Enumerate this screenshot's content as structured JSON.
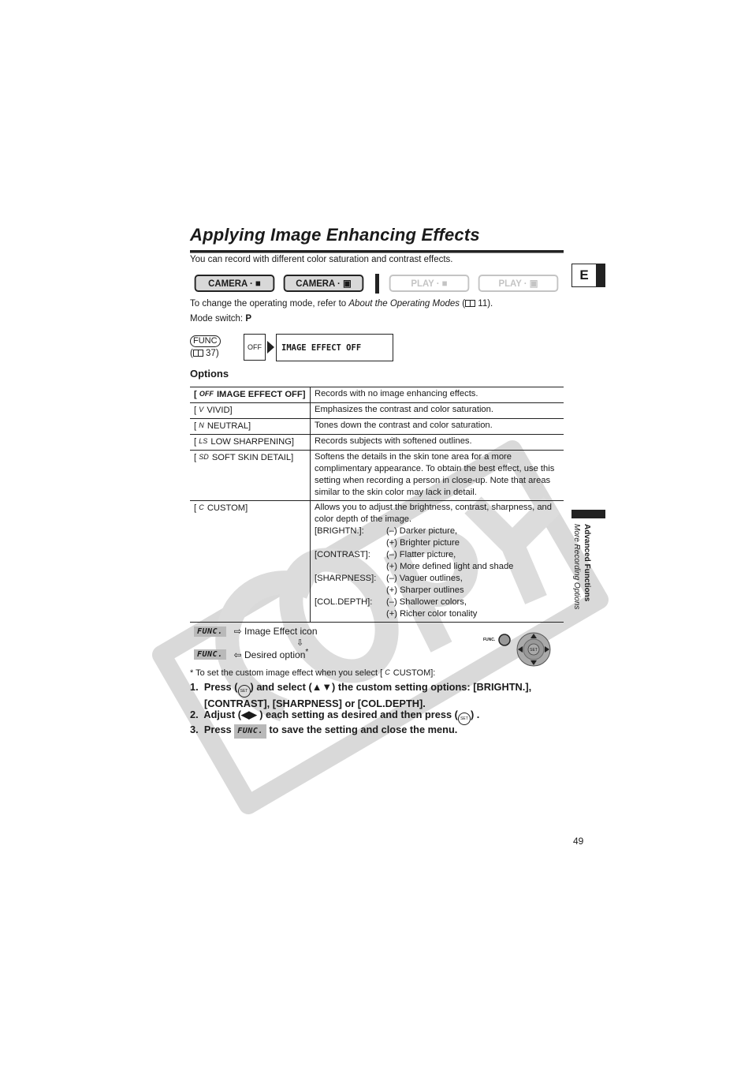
{
  "header": {
    "title": "Applying Image Enhancing Effects",
    "intro": "You can record with different color saturation and contrast effects."
  },
  "modes": [
    {
      "label": "CAMERA · ■",
      "glyph": "movie-camera",
      "active": true
    },
    {
      "label": "CAMERA · ▣",
      "glyph": "still-camera",
      "active": true
    },
    {
      "label": "PLAY · ■",
      "glyph": "movie-camera",
      "active": false
    },
    {
      "label": "PLAY · ▣",
      "glyph": "still-camera",
      "active": false
    }
  ],
  "language_tab": "E",
  "mode_ref": {
    "prefix": "To change the operating mode, refer to ",
    "title": "About the Operating Modes",
    "open": " (",
    "page": " 11).",
    "mode_switch_label": "Mode switch: ",
    "mode_switch_value": "P"
  },
  "func_ref": {
    "func_label": "FUNC",
    "page_open": "(",
    "page": " 37)",
    "lcd_icon": "OFF",
    "lcd_text": "IMAGE EFFECT OFF"
  },
  "options": {
    "heading": "Options",
    "rows": [
      {
        "icon": "OFF",
        "name": " IMAGE EFFECT OFF]",
        "desc": "Records with no image enhancing effects.",
        "bold": true
      },
      {
        "icon": "V",
        "name": " VIVID]",
        "desc": "Emphasizes the contrast and color saturation."
      },
      {
        "icon": "N",
        "name": " NEUTRAL]",
        "desc": "Tones down the contrast and color saturation."
      },
      {
        "icon": "LS",
        "name": " LOW SHARPENING]",
        "desc": "Records subjects with softened outlines."
      },
      {
        "icon": "SD",
        "name": " SOFT SKIN DETAIL]",
        "desc": "Softens the details in the skin tone area for a more complimentary appearance. To obtain the best effect, use this setting when recording a person in close-up. Note that areas similar to the skin color may lack in detail."
      },
      {
        "icon": "C",
        "name": " CUSTOM]",
        "desc": "Allows you to adjust the brightness, contrast, sharpness, and color depth of the image.",
        "settings": [
          {
            "key": "[BRIGHTN.]:",
            "minus": "(–) Darker picture,",
            "plus": "(+) Brighter picture"
          },
          {
            "key": "[CONTRAST]:",
            "minus": "(–) Flatter picture,",
            "plus": "(+) More defined light and shade"
          },
          {
            "key": "[SHARPNESS]:",
            "minus": "(–) Vaguer outlines,",
            "plus": "(+) Sharper outlines"
          },
          {
            "key": "[COL.DEPTH]:",
            "minus": "(–) Shallower colors,",
            "plus": "(+) Richer color tonality"
          }
        ]
      }
    ]
  },
  "flow": {
    "func_tag": "FUNC.",
    "step1": "⇨ Image Effect icon",
    "down": "⇩",
    "step2": "⇦ Desired option",
    "asterisk": "*",
    "dial_func_label": "FUNC.",
    "dial_center": "SET"
  },
  "footnote": {
    "prefix": "* To set the custom image effect when you select [ ",
    "icon": "C",
    "suffix": "  CUSTOM]:"
  },
  "steps": [
    {
      "num": "1.",
      "a": "Press (",
      "set": "SET",
      "b": ") and select (▲▼) the custom setting options: [BRIGHTN.],",
      "c": "[CONTRAST], [SHARPNESS] or [COL.DEPTH]."
    },
    {
      "num": "2.",
      "a": "Adjust (◀▶ ) each setting as desired and then press (",
      "set": "SET",
      "b": ") ."
    },
    {
      "num": "3.",
      "a": "Press ",
      "func": "FUNC.",
      "b": " to save the setting and close the menu."
    }
  ],
  "sidebar": {
    "section": "Advanced Functions",
    "subsection": "More Recording Options"
  },
  "page_number": "49",
  "watermark": "COPY"
}
